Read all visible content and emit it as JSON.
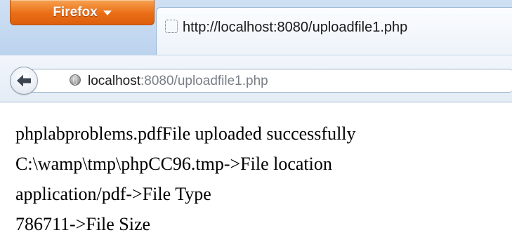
{
  "browser": {
    "menu_button_label": "Firefox",
    "tab": {
      "title": "http://localhost:8080/uploadfile1.php"
    },
    "url": {
      "host": "localhost",
      "rest": ":8080/uploadfile1.php"
    },
    "icons": {
      "menu_dropdown": "chevron-down-icon",
      "back": "back-arrow-icon",
      "site_identity": "globe-icon",
      "tab_favicon": "blank-page-icon"
    },
    "colors": {
      "menu_button": "#ea6d16",
      "chrome": "#cfe0f4",
      "back_arrow": "#3d4650"
    }
  },
  "page": {
    "lines": [
      "phplabproblems.pdfFile uploaded successfully",
      "C:\\wamp\\tmp\\phpCC96.tmp->File location",
      "application/pdf->File Type",
      "786711->File Size"
    ]
  }
}
